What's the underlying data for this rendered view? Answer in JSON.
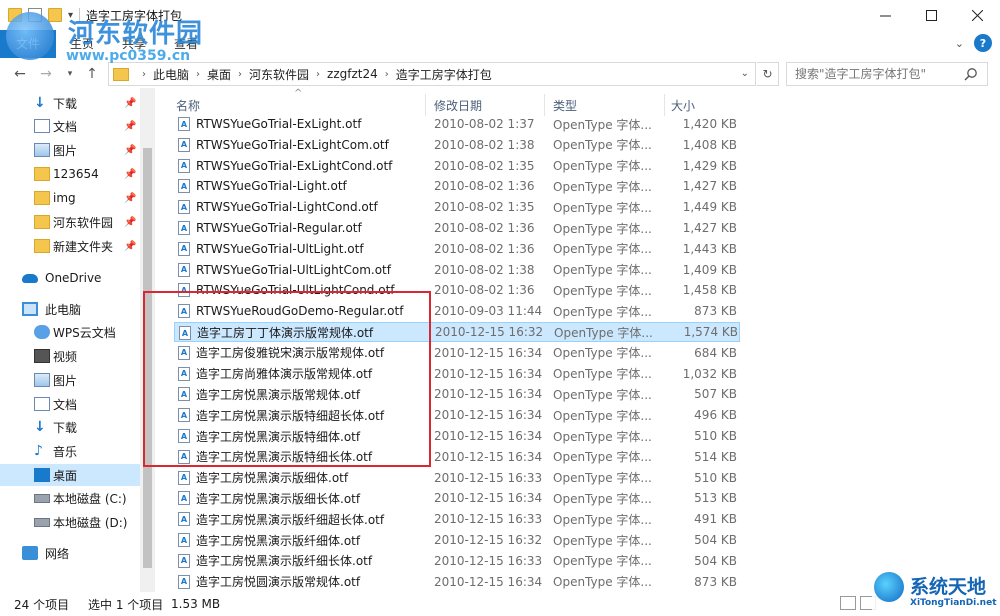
{
  "window": {
    "title": "造字工房字体打包"
  },
  "ribbon": {
    "tabs": [
      "文件",
      "主页",
      "共享",
      "查看"
    ]
  },
  "address": {
    "crumbs": [
      "此电脑",
      "桌面",
      "河东软件园",
      "zzgfzt24",
      "造字工房字体打包"
    ],
    "search_placeholder": "搜索\"造字工房字体打包\""
  },
  "nav": {
    "quick": [
      {
        "label": "下载",
        "icon": "download-icon",
        "pinned": true
      },
      {
        "label": "文档",
        "icon": "document-icon",
        "pinned": true
      },
      {
        "label": "图片",
        "icon": "picture-icon",
        "pinned": true
      },
      {
        "label": "123654",
        "icon": "folder-icon",
        "pinned": true
      },
      {
        "label": "img",
        "icon": "folder-icon",
        "pinned": true
      },
      {
        "label": "河东软件园",
        "icon": "folder-icon",
        "pinned": true
      },
      {
        "label": "新建文件夹",
        "icon": "folder-icon",
        "pinned": true
      }
    ],
    "onedrive": "OneDrive",
    "thispc": "此电脑",
    "pc_items": [
      {
        "label": "WPS云文档",
        "icon": "wps-cloud-icon"
      },
      {
        "label": "视频",
        "icon": "video-icon"
      },
      {
        "label": "图片",
        "icon": "picture-icon"
      },
      {
        "label": "文档",
        "icon": "document-icon"
      },
      {
        "label": "下载",
        "icon": "download-icon"
      },
      {
        "label": "音乐",
        "icon": "music-icon"
      },
      {
        "label": "桌面",
        "icon": "desktop-icon",
        "selected": true
      },
      {
        "label": "本地磁盘 (C:)",
        "icon": "drive-icon"
      },
      {
        "label": "本地磁盘 (D:)",
        "icon": "drive-icon"
      }
    ],
    "network": "网络"
  },
  "columns": {
    "name": "名称",
    "date": "修改日期",
    "type": "类型",
    "size": "大小"
  },
  "files": [
    {
      "name": "RTWSYueGoTrial-ExLight.otf",
      "date": "2010-08-02 1:37",
      "type": "OpenType 字体...",
      "size": "1,420 KB"
    },
    {
      "name": "RTWSYueGoTrial-ExLightCom.otf",
      "date": "2010-08-02 1:38",
      "type": "OpenType 字体...",
      "size": "1,408 KB"
    },
    {
      "name": "RTWSYueGoTrial-ExLightCond.otf",
      "date": "2010-08-02 1:35",
      "type": "OpenType 字体...",
      "size": "1,429 KB"
    },
    {
      "name": "RTWSYueGoTrial-Light.otf",
      "date": "2010-08-02 1:36",
      "type": "OpenType 字体...",
      "size": "1,427 KB"
    },
    {
      "name": "RTWSYueGoTrial-LightCond.otf",
      "date": "2010-08-02 1:35",
      "type": "OpenType 字体...",
      "size": "1,449 KB"
    },
    {
      "name": "RTWSYueGoTrial-Regular.otf",
      "date": "2010-08-02 1:36",
      "type": "OpenType 字体...",
      "size": "1,427 KB"
    },
    {
      "name": "RTWSYueGoTrial-UltLight.otf",
      "date": "2010-08-02 1:36",
      "type": "OpenType 字体...",
      "size": "1,443 KB"
    },
    {
      "name": "RTWSYueGoTrial-UltLightCom.otf",
      "date": "2010-08-02 1:38",
      "type": "OpenType 字体...",
      "size": "1,409 KB"
    },
    {
      "name": "RTWSYueGoTrial-UltLightCond.otf",
      "date": "2010-08-02 1:36",
      "type": "OpenType 字体...",
      "size": "1,458 KB"
    },
    {
      "name": "RTWSYueRoudGoDemo-Regular.otf",
      "date": "2010-09-03 11:44",
      "type": "OpenType 字体...",
      "size": "873 KB"
    },
    {
      "name": "造字工房丁丁体演示版常规体.otf",
      "date": "2010-12-15 16:32",
      "type": "OpenType 字体...",
      "size": "1,574 KB",
      "selected": true
    },
    {
      "name": "造字工房俊雅锐宋演示版常规体.otf",
      "date": "2010-12-15 16:34",
      "type": "OpenType 字体...",
      "size": "684 KB"
    },
    {
      "name": "造字工房尚雅体演示版常规体.otf",
      "date": "2010-12-15 16:34",
      "type": "OpenType 字体...",
      "size": "1,032 KB"
    },
    {
      "name": "造字工房悦黑演示版常规体.otf",
      "date": "2010-12-15 16:34",
      "type": "OpenType 字体...",
      "size": "507 KB"
    },
    {
      "name": "造字工房悦黑演示版特细超长体.otf",
      "date": "2010-12-15 16:34",
      "type": "OpenType 字体...",
      "size": "496 KB"
    },
    {
      "name": "造字工房悦黑演示版特细体.otf",
      "date": "2010-12-15 16:34",
      "type": "OpenType 字体...",
      "size": "510 KB"
    },
    {
      "name": "造字工房悦黑演示版特细长体.otf",
      "date": "2010-12-15 16:34",
      "type": "OpenType 字体...",
      "size": "514 KB"
    },
    {
      "name": "造字工房悦黑演示版细体.otf",
      "date": "2010-12-15 16:33",
      "type": "OpenType 字体...",
      "size": "510 KB"
    },
    {
      "name": "造字工房悦黑演示版细长体.otf",
      "date": "2010-12-15 16:34",
      "type": "OpenType 字体...",
      "size": "513 KB"
    },
    {
      "name": "造字工房悦黑演示版纤细超长体.otf",
      "date": "2010-12-15 16:33",
      "type": "OpenType 字体...",
      "size": "491 KB"
    },
    {
      "name": "造字工房悦黑演示版纤细体.otf",
      "date": "2010-12-15 16:32",
      "type": "OpenType 字体...",
      "size": "504 KB"
    },
    {
      "name": "造字工房悦黑演示版纤细长体.otf",
      "date": "2010-12-15 16:33",
      "type": "OpenType 字体...",
      "size": "504 KB"
    },
    {
      "name": "造字工房悦圆演示版常规体.otf",
      "date": "2010-12-15 16:34",
      "type": "OpenType 字体...",
      "size": "873 KB"
    }
  ],
  "status": {
    "count": "24 个项目",
    "selected": "选中 1 个项目",
    "size": "1.53 MB"
  },
  "watermark": {
    "site_name": "河东软件园",
    "site_url": "www.pc0359.cn",
    "brand2": "系统天地",
    "brand2_url": "XiTongTianDi.net"
  },
  "colors": {
    "accent": "#1979ca",
    "selection": "#cce8ff",
    "highlight_box": "#d9282f"
  }
}
